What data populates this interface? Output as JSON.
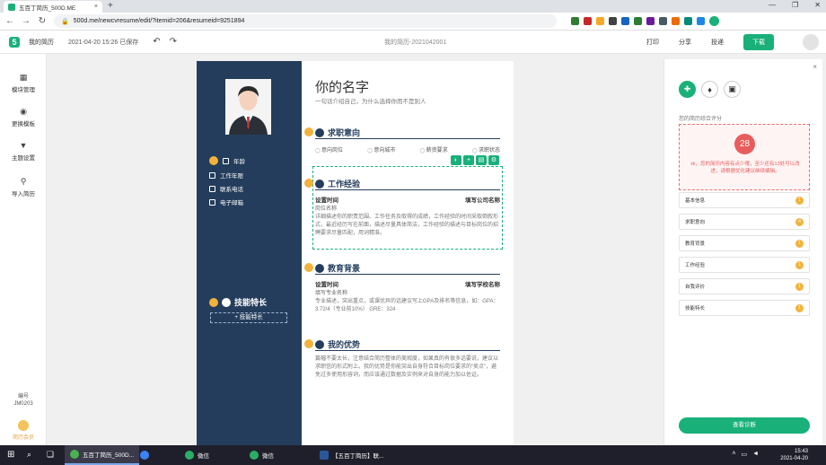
{
  "browser": {
    "tab_title": "五百丁简历_500D.ME",
    "tab_close": "×",
    "new_tab": "+",
    "window_controls": [
      "—",
      "❐",
      "✕"
    ],
    "url": "500d.me/newcvresume/edit/?itemid=206&resumeid=9251894"
  },
  "app_header": {
    "logo": "5",
    "my_resume": "我的简历",
    "saved_status": "2021-04-20 15:26 已保存",
    "doc_name": "我的简历-2021042001",
    "print": "打印",
    "share": "分享",
    "deliver": "投递",
    "download": "下载"
  },
  "left_sidebar": {
    "items": [
      {
        "label": "模块管理"
      },
      {
        "label": "更换模板"
      },
      {
        "label": "主题设置"
      },
      {
        "label": "导入简历"
      }
    ],
    "number_label": "编号",
    "number_value": "JM0203",
    "vip_label": "简历会员"
  },
  "resume": {
    "info": {
      "age": "年龄",
      "work_years": "工作年限",
      "phone": "联系电话",
      "email": "电子邮箱"
    },
    "skills_title": "技能特长",
    "add_skill": "+ 技能特长",
    "name": "你的名字",
    "tagline": "一句话介绍自己，为什么选择你而不是别人",
    "sections": {
      "intent": {
        "title": "求职意向",
        "fields": [
          "意向岗位",
          "意向城市",
          "薪资要求",
          "求职状态"
        ]
      },
      "work": {
        "title": "工作经验",
        "time": "设置时间",
        "company": "填写公司名称",
        "position": "岗位名称",
        "desc": "详细描述你的职责范围、工作任务及取得的成绩，工作经验的时间采取倒叙形式，最近经历写在前面，描述尽量具体简洁，工作经验的描述与目标岗位的招聘要求尽量匹配，用词精准。"
      },
      "education": {
        "title": "教育背景",
        "time": "设置时间",
        "school": "填写学校名称",
        "major": "填写专业名称",
        "desc": "专业描述，突出重点，或课优异的话建议写上GPA及排名等信息，如：GPA：3.72/4（专业前10%） GRE：324"
      },
      "advantage": {
        "title": "我的优势",
        "desc": "篇幅不要太长，注意结合简历整体的美观度，如果真的有很多话要说，建议以求职信的形式附上。我的优势是你能突出自身符合目标岗位要求的“卖点”，避免过多使用形容词，而应该通过数据及实例来对自身的能力加以佐证。"
      }
    },
    "toolbar": [
      "◐",
      "+",
      "▤",
      "⚙"
    ]
  },
  "right_panel": {
    "close": "×",
    "tab_icons": [
      "✚",
      "♦",
      "▣"
    ],
    "score_label": "您的简历综合评分",
    "score": "28",
    "score_tip": "Hi，您的简历内容有点少哦，至少还有13处可以改进，请根据优化建议继续编辑。",
    "items": [
      {
        "label": "基本信息",
        "count": "1"
      },
      {
        "label": "求职意向",
        "count": "4"
      },
      {
        "label": "教育背景",
        "count": "1"
      },
      {
        "label": "工作经验",
        "count": "1"
      },
      {
        "label": "自我评价",
        "count": "1"
      },
      {
        "label": "技能特长",
        "count": "1"
      }
    ],
    "button": "查看诊断"
  },
  "taskbar": {
    "apps": [
      {
        "label": "五百丁简历_500D..."
      },
      {
        "label": ""
      },
      {
        "label": "微信"
      },
      {
        "label": "微信"
      },
      {
        "label": "【五百丁简历】联..."
      }
    ],
    "time": "15:43",
    "date": "2021-04-20"
  },
  "colors": {
    "accent": "#19b07a",
    "sidebar_dark": "#243d5c",
    "mark": "#f3b23b",
    "score_red": "#e95c5c"
  }
}
